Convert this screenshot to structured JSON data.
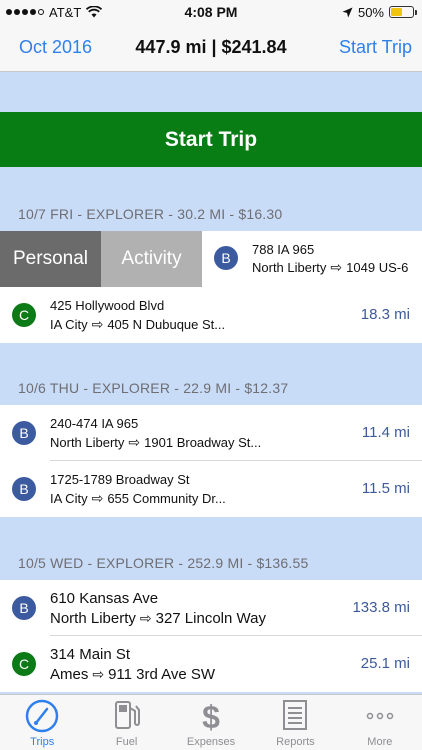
{
  "status_bar": {
    "carrier": "AT&T",
    "time": "4:08 PM",
    "battery": "50%"
  },
  "nav": {
    "left": "Oct 2016",
    "title": "447.9 mi | $241.84",
    "right": "Start Trip"
  },
  "start_button": "Start Trip",
  "sections": [
    {
      "header": "10/7 FRI - EXPLORER - 30.2 MI - $16.30",
      "swipe_actions": [
        "Personal",
        "Activity"
      ],
      "trips": [
        {
          "badge": "B",
          "from": "788 IA 965",
          "to_city": "North Liberty",
          "to_addr": "1049 US-6",
          "miles": ""
        },
        {
          "badge": "C",
          "from": "425 Hollywood Blvd",
          "to_city": "IA City",
          "to_addr": "405 N Dubuque St...",
          "miles": "18.3 mi"
        }
      ]
    },
    {
      "header": "10/6 THU - EXPLORER - 22.9 MI - $12.37",
      "trips": [
        {
          "badge": "B",
          "from": "240-474 IA 965",
          "to_city": "North Liberty",
          "to_addr": "1901 Broadway St...",
          "miles": "11.4 mi"
        },
        {
          "badge": "B",
          "from": "1725-1789 Broadway St",
          "to_city": "IA City",
          "to_addr": "655 Community Dr...",
          "miles": "11.5 mi"
        }
      ]
    },
    {
      "header": "10/5 WED - EXPLORER - 252.9 MI - $136.55",
      "trips": [
        {
          "badge": "B",
          "from": "610 Kansas Ave",
          "to_city": "North Liberty",
          "to_addr": "327 Lincoln Way",
          "miles": "133.8 mi"
        },
        {
          "badge": "C",
          "from": "314 Main St",
          "to_city": "Ames",
          "to_addr": "911 3rd Ave SW",
          "miles": "25.1 mi"
        }
      ]
    }
  ],
  "tabs": [
    {
      "label": "Trips",
      "icon": "trips-gauge-icon",
      "active": true
    },
    {
      "label": "Fuel",
      "icon": "fuel-pump-icon",
      "active": false
    },
    {
      "label": "Expenses",
      "icon": "dollar-icon",
      "active": false
    },
    {
      "label": "Reports",
      "icon": "reports-icon",
      "active": false
    },
    {
      "label": "More",
      "icon": "more-dots-icon",
      "active": false
    }
  ],
  "colors": {
    "accent": "#2f80ed",
    "start_green": "#087d14",
    "badge_b": "#3c5aa0",
    "badge_c": "#0b7a17",
    "background": "#c9dcf7"
  }
}
